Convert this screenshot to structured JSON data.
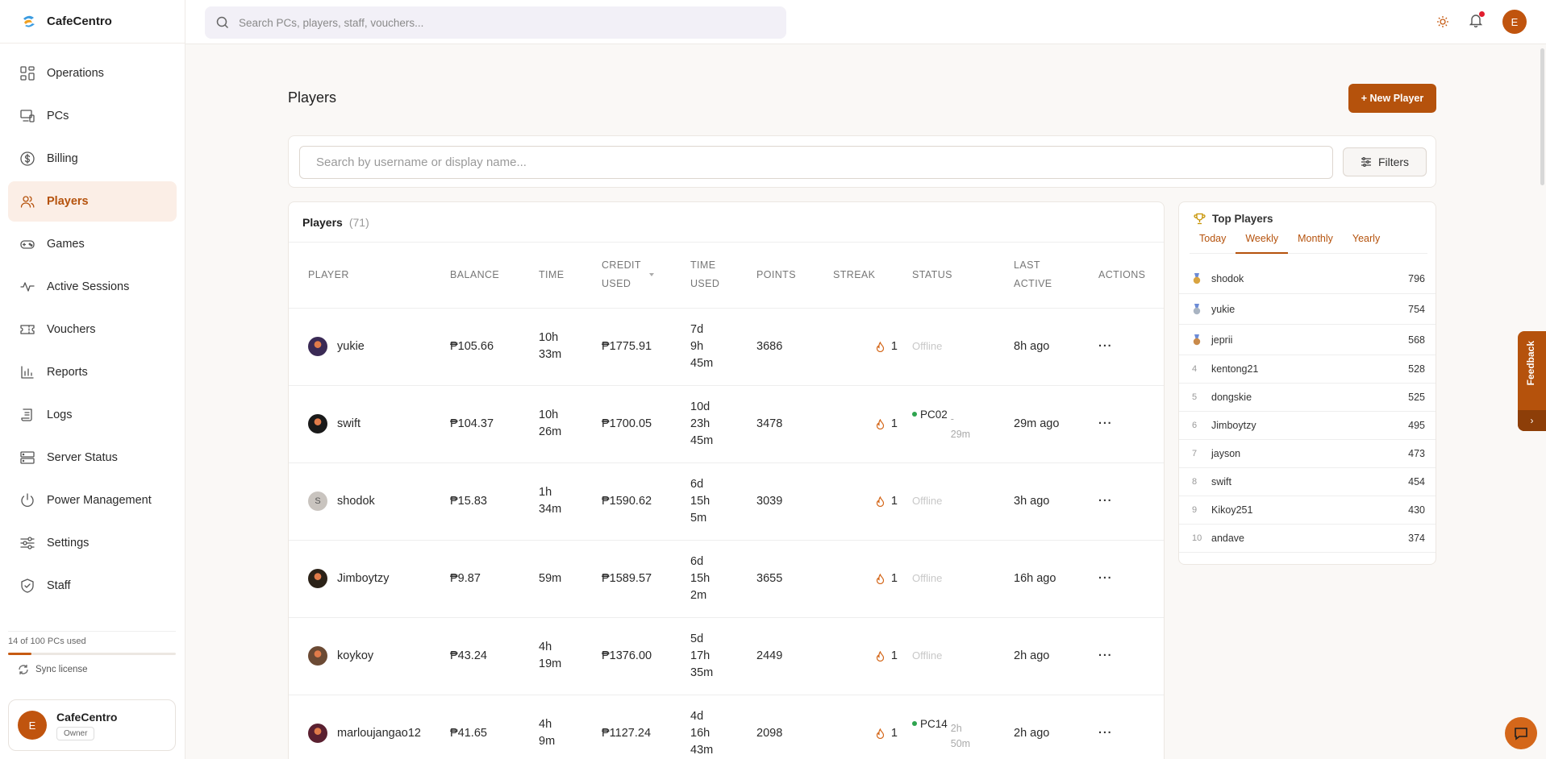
{
  "app": {
    "name": "CafeCentro"
  },
  "nav": [
    {
      "label": "Operations",
      "icon": "grid-icon"
    },
    {
      "label": "PCs",
      "icon": "devices-icon"
    },
    {
      "label": "Billing",
      "icon": "dollar-circle-icon"
    },
    {
      "label": "Players",
      "icon": "users-icon",
      "active": true
    },
    {
      "label": "Games",
      "icon": "gamepad-icon"
    },
    {
      "label": "Active Sessions",
      "icon": "activity-icon"
    },
    {
      "label": "Vouchers",
      "icon": "ticket-icon"
    },
    {
      "label": "Reports",
      "icon": "bar-chart-icon"
    },
    {
      "label": "Logs",
      "icon": "scroll-icon"
    },
    {
      "label": "Server Status",
      "icon": "server-icon"
    },
    {
      "label": "Power Management",
      "icon": "power-icon"
    },
    {
      "label": "Settings",
      "icon": "sliders-icon"
    },
    {
      "label": "Staff",
      "icon": "shield-icon"
    }
  ],
  "license": {
    "usage_text": "14 of 100 PCs used",
    "used_fraction": 0.14,
    "sync_label": "Sync license"
  },
  "profile": {
    "initial": "E",
    "name": "CafeCentro",
    "role": "Owner"
  },
  "topbar": {
    "search_placeholder": "Search PCs, players, staff, vouchers...",
    "avatar_initial": "E"
  },
  "page": {
    "title": "Players",
    "new_player_label": "+ New Player",
    "search_placeholder": "Search by username or display name...",
    "filters_label": "Filters"
  },
  "table": {
    "title": "Players",
    "count": "(71)",
    "headers": {
      "player": "PLAYER",
      "balance": "BALANCE",
      "time": "TIME",
      "credit_used_1": "CREDIT",
      "credit_used_2": "USED",
      "time_used_1": "TIME",
      "time_used_2": "USED",
      "points": "POINTS",
      "streak": "STREAK",
      "status": "STATUS",
      "last_active_1": "LAST",
      "last_active_2": "ACTIVE",
      "actions": "ACTIONS"
    },
    "rows": [
      {
        "name": "yukie",
        "balance": "₱105.66",
        "time": [
          "10h",
          "33m"
        ],
        "credit_used": "₱1775.91",
        "time_used": [
          "7d",
          "9h",
          "45m"
        ],
        "points": "3686",
        "streak": "1",
        "status": "Offline",
        "pc": "",
        "pc_time": [],
        "last_active": "8h ago",
        "avatar_color": "#3a2a55"
      },
      {
        "name": "swift",
        "balance": "₱104.37",
        "time": [
          "10h",
          "26m"
        ],
        "credit_used": "₱1700.05",
        "time_used": [
          "10d",
          "23h",
          "45m"
        ],
        "points": "3478",
        "streak": "1",
        "status": "online",
        "pc": "PC02",
        "pc_time": [
          "-",
          "29m"
        ],
        "last_active": "29m ago",
        "avatar_color": "#1a1a1a"
      },
      {
        "name": "shodok",
        "balance": "₱15.83",
        "time": [
          "1h",
          "34m"
        ],
        "credit_used": "₱1590.62",
        "time_used": [
          "6d",
          "15h",
          "5m"
        ],
        "points": "3039",
        "streak": "1",
        "status": "Offline",
        "pc": "",
        "pc_time": [],
        "last_active": "3h ago",
        "avatar_initial": "S"
      },
      {
        "name": "Jimboytzy",
        "balance": "₱9.87",
        "time": [
          "59m"
        ],
        "credit_used": "₱1589.57",
        "time_used": [
          "6d",
          "15h",
          "2m"
        ],
        "points": "3655",
        "streak": "1",
        "status": "Offline",
        "pc": "",
        "pc_time": [],
        "last_active": "16h ago",
        "avatar_color": "#2b2218"
      },
      {
        "name": "koykoy",
        "balance": "₱43.24",
        "time": [
          "4h",
          "19m"
        ],
        "credit_used": "₱1376.00",
        "time_used": [
          "5d",
          "17h",
          "35m"
        ],
        "points": "2449",
        "streak": "1",
        "status": "Offline",
        "pc": "",
        "pc_time": [],
        "last_active": "2h ago",
        "avatar_color": "#6b4a34"
      },
      {
        "name": "marloujangao12",
        "balance": "₱41.65",
        "time": [
          "4h",
          "9m"
        ],
        "credit_used": "₱1127.24",
        "time_used": [
          "4d",
          "16h",
          "43m"
        ],
        "points": "2098",
        "streak": "1",
        "status": "online",
        "pc": "PC14",
        "pc_time": [
          "2h",
          "50m"
        ],
        "last_active": "2h ago",
        "avatar_color": "#5a2030"
      }
    ]
  },
  "top_players": {
    "title": "Top Players",
    "tabs": [
      "Today",
      "Weekly",
      "Monthly",
      "Yearly"
    ],
    "active_tab": "Weekly",
    "list": [
      {
        "rank": "1",
        "name": "shodok",
        "points": "796",
        "medal": "gold"
      },
      {
        "rank": "2",
        "name": "yukie",
        "points": "754",
        "medal": "silver"
      },
      {
        "rank": "3",
        "name": "jeprii",
        "points": "568",
        "medal": "bronze"
      },
      {
        "rank": "4",
        "name": "kentong21",
        "points": "528"
      },
      {
        "rank": "5",
        "name": "dongskie",
        "points": "525"
      },
      {
        "rank": "6",
        "name": "Jimboytzy",
        "points": "495"
      },
      {
        "rank": "7",
        "name": "jayson",
        "points": "473"
      },
      {
        "rank": "8",
        "name": "swift",
        "points": "454"
      },
      {
        "rank": "9",
        "name": "Kikoy251",
        "points": "430"
      },
      {
        "rank": "10",
        "name": "andave",
        "points": "374"
      }
    ]
  },
  "feedback": {
    "label": "Feedback",
    "arrow": "›"
  },
  "colors": {
    "accent": "#b5520c",
    "accent_light": "#fbeee6",
    "online": "#2ea44f",
    "notification": "#e11d2e"
  }
}
